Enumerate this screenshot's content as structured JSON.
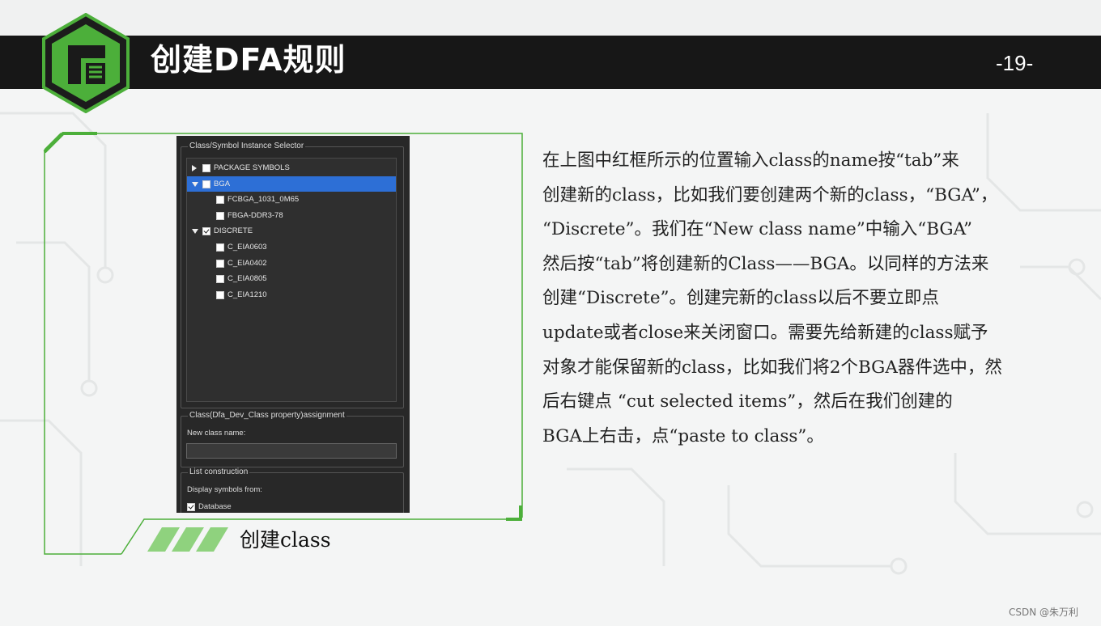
{
  "slide": {
    "title": "创建DFA规则",
    "page_number": "-19-",
    "caption": "创建class",
    "watermark": "CSDN @朱万利"
  },
  "colors": {
    "accent_green": "#4caf3a",
    "title_bar": "#171717",
    "selection_blue": "#2d6fd6"
  },
  "dialog": {
    "selector_title": "Class/Symbol Instance Selector",
    "tree": [
      {
        "label": "PACKAGE SYMBOLS",
        "expander": "collapsed",
        "checked": false,
        "selected": false,
        "level": 0
      },
      {
        "label": "BGA",
        "expander": "expanded",
        "checked": false,
        "selected": true,
        "level": 0
      },
      {
        "label": "FCBGA_1031_0M65",
        "expander": "none",
        "checked": false,
        "selected": false,
        "level": 1
      },
      {
        "label": "FBGA-DDR3-78",
        "expander": "none",
        "checked": false,
        "selected": false,
        "level": 1
      },
      {
        "label": "DISCRETE",
        "expander": "expanded",
        "checked": true,
        "selected": false,
        "level": 0
      },
      {
        "label": "C_EIA0603",
        "expander": "none",
        "checked": false,
        "selected": false,
        "level": 1
      },
      {
        "label": "C_EIA0402",
        "expander": "none",
        "checked": false,
        "selected": false,
        "level": 1
      },
      {
        "label": "C_EIA0805",
        "expander": "none",
        "checked": false,
        "selected": false,
        "level": 1
      },
      {
        "label": "C_EIA1210",
        "expander": "none",
        "checked": false,
        "selected": false,
        "level": 1
      }
    ],
    "assignment_title": "Class(Dfa_Dev_Class property)assignment",
    "new_class_label": "New class name:",
    "new_class_value": "",
    "list_title": "List construction",
    "display_from_label": "Display symbols from:",
    "database_label": "Database",
    "database_checked": true
  },
  "body_lines": [
    "  在上图中红框所示的位置输入class的name按“tab”来",
    "创建新的class，比如我们要创建两个新的class，“BGA”，",
    "“Discrete”。我们在“New class name”中输入“BGA”",
    "然后按“tab”将创建新的Class——BGA。以同样的方法来",
    "创建“Discrete”。创建完新的class以后不要立即点",
    "update或者close来关闭窗口。需要先给新建的class赋予",
    "对象才能保留新的class，比如我们将2个BGA器件选中，然",
    "后右键点 “cut selected items”，然后在我们创建的",
    "BGA上右击，点“paste to class”。"
  ]
}
